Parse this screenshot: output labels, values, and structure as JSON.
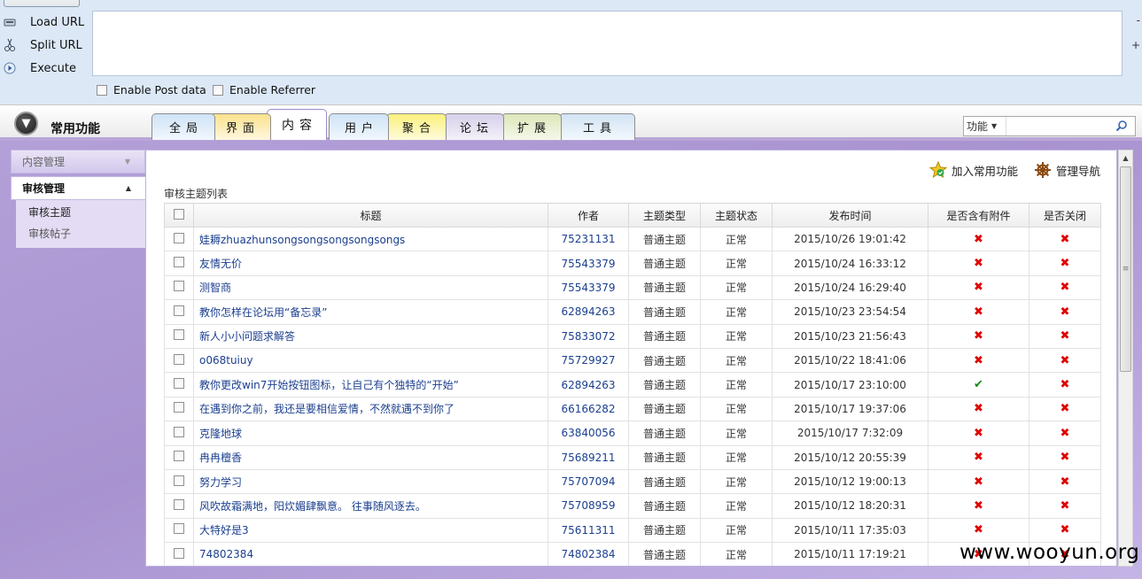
{
  "hackbar": {
    "tools": [
      {
        "label": "Load URL",
        "icon": "load-url-icon"
      },
      {
        "label": "Split URL",
        "icon": "split-url-icon"
      },
      {
        "label": "Execute",
        "icon": "execute-icon"
      }
    ],
    "side_minus": "-",
    "side_plus": "+",
    "enable_post": "Enable Post data",
    "enable_referrer": "Enable Referrer"
  },
  "band": {
    "title": "常用功能",
    "tabs": [
      {
        "label": "全局",
        "color": "#cfe3f7"
      },
      {
        "label": "界面",
        "color": "#fbe28d"
      },
      {
        "label": "内容",
        "color": "#ffffff"
      },
      {
        "label": "用户",
        "color": "#cfe3f7"
      },
      {
        "label": "聚合",
        "color": "#fbf07e"
      },
      {
        "label": "论坛",
        "color": "#d6d0ea"
      },
      {
        "label": "扩展",
        "color": "#dce6b8"
      },
      {
        "label": "工具",
        "color": "#d2e4f4"
      }
    ],
    "search": {
      "select": "功能"
    }
  },
  "sidebar": {
    "group_closed": "内容管理",
    "group_open": "审核管理",
    "items": [
      "审核主题",
      "审核帖子"
    ]
  },
  "main": {
    "actions": {
      "add_favorite": "加入常用功能",
      "nav": "管理导航"
    },
    "list_title": "审核主题列表",
    "columns": [
      "标题",
      "作者",
      "主题类型",
      "主题状态",
      "发布时间",
      "是否含有附件",
      "是否关闭"
    ],
    "rows": [
      {
        "title": "娃耨zhuazhunsongsongsongsongsongs",
        "author": "75231131",
        "type": "普通主题",
        "status": "正常",
        "time": "2015/10/26 19:01:42",
        "attach": false,
        "closed": false
      },
      {
        "title": "友情无价",
        "author": "75543379",
        "type": "普通主题",
        "status": "正常",
        "time": "2015/10/24 16:33:12",
        "attach": false,
        "closed": false
      },
      {
        "title": "测智商",
        "author": "75543379",
        "type": "普通主题",
        "status": "正常",
        "time": "2015/10/24 16:29:40",
        "attach": false,
        "closed": false
      },
      {
        "title": "教你怎样在论坛用“备忘录”",
        "author": "62894263",
        "type": "普通主题",
        "status": "正常",
        "time": "2015/10/23 23:54:54",
        "attach": false,
        "closed": false
      },
      {
        "title": "新人小小问题求解答",
        "author": "75833072",
        "type": "普通主题",
        "status": "正常",
        "time": "2015/10/23 21:56:43",
        "attach": false,
        "closed": false
      },
      {
        "title": "o068tuiuy",
        "author": "75729927",
        "type": "普通主题",
        "status": "正常",
        "time": "2015/10/22 18:41:06",
        "attach": false,
        "closed": false
      },
      {
        "title": "教你更改win7开始按钮图标，让自己有个独特的“开始”",
        "author": "62894263",
        "type": "普通主题",
        "status": "正常",
        "time": "2015/10/17 23:10:00",
        "attach": true,
        "closed": false
      },
      {
        "title": "在遇到你之前，我还是要相信爱情，不然就遇不到你了",
        "author": "66166282",
        "type": "普通主题",
        "status": "正常",
        "time": "2015/10/17 19:37:06",
        "attach": false,
        "closed": false
      },
      {
        "title": "克隆地球",
        "author": "63840056",
        "type": "普通主题",
        "status": "正常",
        "time": "2015/10/17 7:32:09",
        "attach": false,
        "closed": false
      },
      {
        "title": "冉冉檀香",
        "author": "75689211",
        "type": "普通主题",
        "status": "正常",
        "time": "2015/10/12 20:55:39",
        "attach": false,
        "closed": false
      },
      {
        "title": "努力学习",
        "author": "75707094",
        "type": "普通主题",
        "status": "正常",
        "time": "2015/10/12 19:00:13",
        "attach": false,
        "closed": false
      },
      {
        "title": "风吹故霜满地，阳炊媚肆飘意。 往事随风逐去。",
        "author": "75708959",
        "type": "普通主题",
        "status": "正常",
        "time": "2015/10/12 18:20:31",
        "attach": false,
        "closed": false
      },
      {
        "title": "大特好是3",
        "author": "75611311",
        "type": "普通主题",
        "status": "正常",
        "time": "2015/10/11 17:35:03",
        "attach": false,
        "closed": false
      },
      {
        "title": "74802384",
        "author": "74802384",
        "type": "普通主题",
        "status": "正常",
        "time": "2015/10/11 17:19:21",
        "attach": false,
        "closed": false
      }
    ],
    "mark_yes": "✔",
    "mark_no": "✖"
  },
  "watermark": "www.wooyun.org"
}
